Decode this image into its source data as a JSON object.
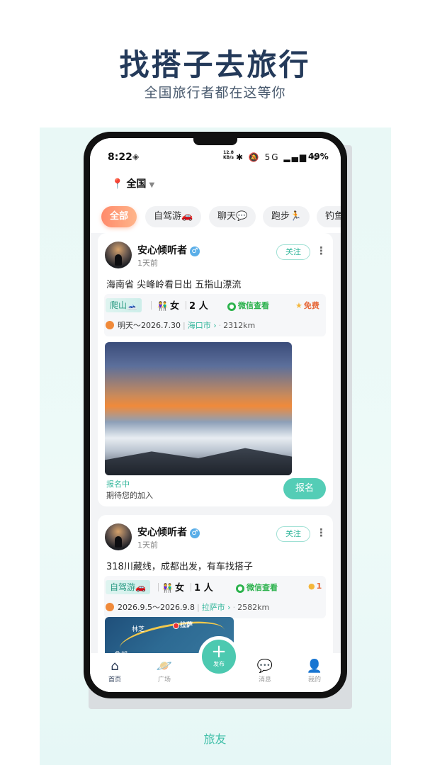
{
  "promo": {
    "headline": "找搭子去旅行",
    "subline": "全国旅行者都在这等你",
    "caption": "旅友"
  },
  "statusbar": {
    "time": "8:22",
    "network_speed_value": "12.8",
    "network_speed_unit": "KB/s",
    "signal_icons": "✱ 🔕 5G ▂▄▆ ᯤ",
    "battery": "49%"
  },
  "location": {
    "label": "全国"
  },
  "chips": [
    "全部",
    "自驾游🚗",
    "聊天💬",
    "跑步🏃",
    "钓鱼"
  ],
  "posts": [
    {
      "username": "安心倾听者",
      "gender": "♂",
      "time": "1天前",
      "follow": "关注",
      "text": "海南省 尖峰岭看日出 五指山漂流",
      "tag": "爬山🗻",
      "gender_req": "女",
      "people": "2 人",
      "wechat": "微信查看",
      "fee": "免费",
      "dates": "明天～2026.7.30",
      "city": "海口市 ›",
      "distance": "2312km",
      "status": "报名中",
      "status_sub": "期待您的加入",
      "signup": "报名"
    },
    {
      "username": "安心倾听者",
      "gender": "♂",
      "time": "1天前",
      "follow": "关注",
      "text": "318川藏线，成都出发，有车找搭子",
      "tag": "自驾游🚗",
      "gender_req": "女",
      "people": "1 人",
      "wechat": "微信查看",
      "fee": "1",
      "dates": "2026.9.5～2026.9.8",
      "city": "拉萨市 ›",
      "distance": "2582km",
      "map_labels": [
        "林芝",
        "拉萨",
        "鲁朗"
      ]
    }
  ],
  "tabbar": {
    "home": "首页",
    "square": "广场",
    "publish": "发布",
    "messages": "消息",
    "mine": "我的"
  },
  "colors": {
    "accent": "#4cc9b0",
    "headline": "#243a5a",
    "chip_active": "#ff8a6b"
  }
}
